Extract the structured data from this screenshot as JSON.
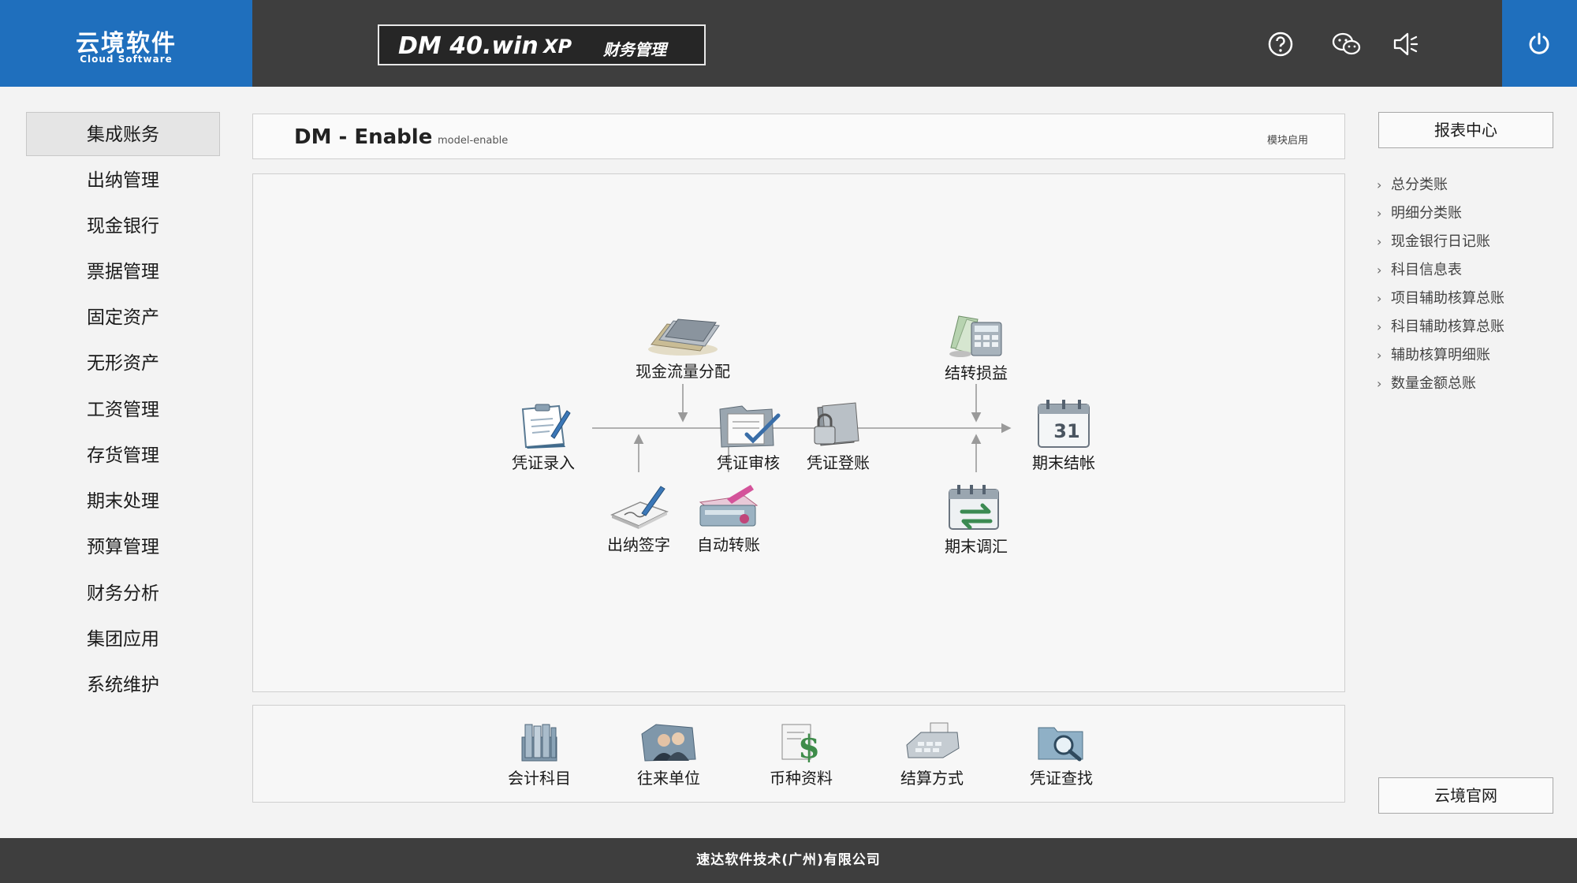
{
  "header": {
    "logo_cn": "云境软件",
    "logo_en": "Cloud Software",
    "product_main": "DM 40.win",
    "product_xp": "XP",
    "product_cn": "财务管理",
    "icons": [
      "help-icon",
      "wechat-icon",
      "volume-icon",
      "power-icon"
    ],
    "accent": "#1f6fbd",
    "bar_color": "#3e3e3e"
  },
  "sidebar": {
    "items": [
      {
        "label": "集成账务",
        "active": true
      },
      {
        "label": "出纳管理"
      },
      {
        "label": "现金银行"
      },
      {
        "label": "票据管理"
      },
      {
        "label": "固定资产"
      },
      {
        "label": "无形资产"
      },
      {
        "label": "工资管理"
      },
      {
        "label": "存货管理"
      },
      {
        "label": "期末处理"
      },
      {
        "label": "预算管理"
      },
      {
        "label": "财务分析"
      },
      {
        "label": "集团应用"
      },
      {
        "label": "系统维护"
      }
    ]
  },
  "titlebar": {
    "title": "DM - Enable",
    "subtitle": "model-enable",
    "right_label": "模块启用"
  },
  "flow": {
    "nodes": {
      "voucher_entry": "凭证录入",
      "cash_flow": "现金流量分配",
      "cashier_sign": "出纳签字",
      "auto_transfer": "自动转账",
      "voucher_audit": "凭证审核",
      "voucher_post": "凭证登账",
      "carry_profit": "结转损益",
      "period_adjust": "期末调汇",
      "period_close": "期末结帐"
    }
  },
  "bottom": {
    "items": [
      "会计科目",
      "往来单位",
      "币种资料",
      "结算方式",
      "凭证查找"
    ]
  },
  "right": {
    "report_button": "报表中心",
    "links": [
      "总分类账",
      "明细分类账",
      "现金银行日记账",
      "科目信息表",
      "项目辅助核算总账",
      "科目辅助核算总账",
      "辅助核算明细账",
      "数量金额总账"
    ],
    "website_button": "云境官网"
  },
  "footer": {
    "company": "速达软件技术(广州)有限公司"
  }
}
